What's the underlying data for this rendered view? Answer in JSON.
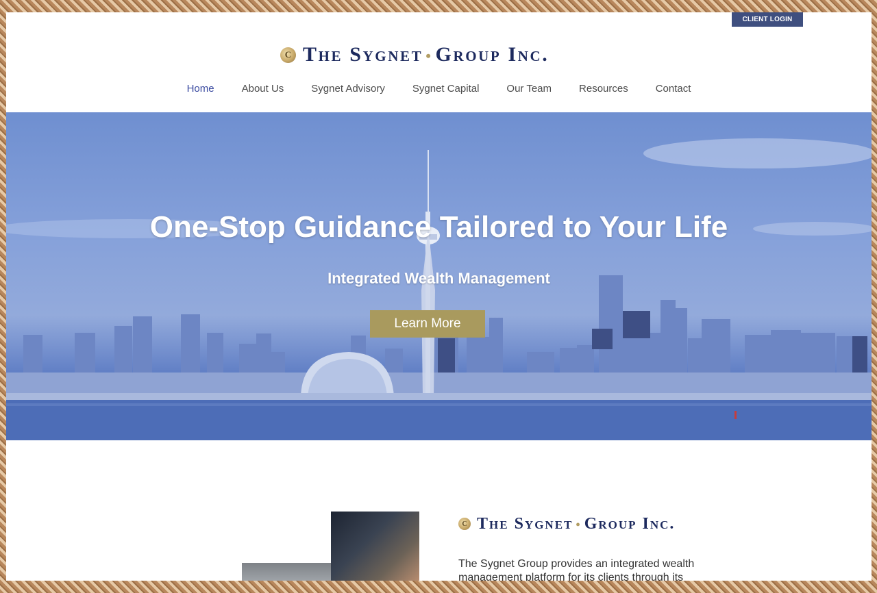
{
  "header": {
    "client_login": "CLIENT LOGIN",
    "logo_text": "The Sygnet",
    "logo_text_b": "Group Inc.",
    "logo_seal": "C"
  },
  "nav": {
    "items": [
      {
        "label": "Home",
        "active": true
      },
      {
        "label": "About Us",
        "active": false
      },
      {
        "label": "Sygnet Advisory",
        "active": false
      },
      {
        "label": "Sygnet Capital",
        "active": false
      },
      {
        "label": "Our Team",
        "active": false
      },
      {
        "label": "Resources",
        "active": false
      },
      {
        "label": "Contact",
        "active": false
      }
    ]
  },
  "hero": {
    "title": "One-Stop Guidance Tailored to Your Life",
    "subtitle": "Integrated Wealth Management",
    "cta": "Learn More"
  },
  "about": {
    "logo_text": "The Sygnet",
    "logo_text_b": "Group Inc.",
    "body": "The Sygnet Group provides an integrated wealth management platform for its clients through its"
  },
  "colors": {
    "accent": "#a99a5e",
    "brand_navy": "#1d2a5e",
    "login_button": "#3f4f7f",
    "nav_active": "#3a4aa0"
  }
}
